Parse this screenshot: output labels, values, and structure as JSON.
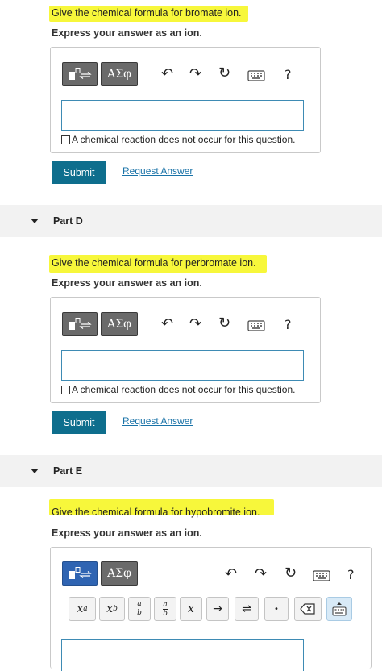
{
  "part_c": {
    "prompt": "Give the chemical formula for bromate ion.",
    "express": "Express your answer as an ion.",
    "no_reaction_label": "A chemical reaction does not occur for this question.",
    "submit_label": "Submit",
    "request_label": "Request Answer"
  },
  "part_d": {
    "title": "Part D",
    "prompt": "Give the chemical formula for perbromate ion.",
    "express": "Express your answer as an ion.",
    "no_reaction_label": "A chemical reaction does not occur for this question.",
    "submit_label": "Submit",
    "request_label": "Request Answer"
  },
  "part_e": {
    "title": "Part E",
    "prompt": "Give the chemical formula for hypobromite ion.",
    "express": "Express your answer as an ion."
  },
  "toolbar": {
    "greek_label": "ΑΣφ",
    "help_label": "?"
  },
  "math_buttons": {
    "superscript": "x",
    "superscript_exp": "a",
    "subscript": "x",
    "subscript_sub": "b",
    "fraction_num": "a",
    "fraction_den": "b",
    "overline": "x",
    "arrow": "→",
    "equilibrium": "⇌",
    "dot": "•"
  },
  "colors": {
    "highlight": "#f7f73b",
    "submit": "#0e6e8d",
    "link": "#1a73a8",
    "template_active": "#2f64b2"
  }
}
